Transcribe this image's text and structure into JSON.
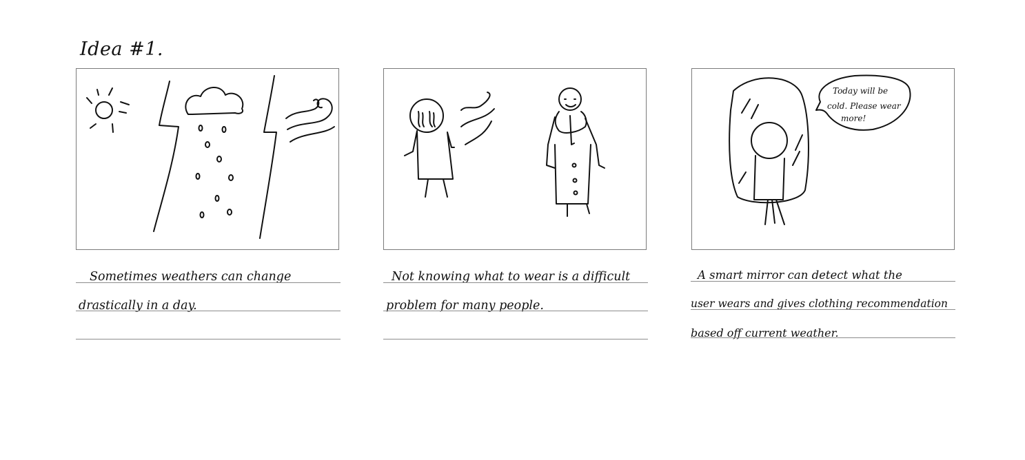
{
  "page": {
    "title": "Idea #1."
  },
  "panels": [
    {
      "caption_lines": [
        "Sometimes weathers can change",
        "drastically in a day."
      ]
    },
    {
      "caption_lines": [
        "Not knowing what to wear is a difficult",
        "problem for many people."
      ]
    },
    {
      "speech_bubble_lines": [
        "Today will be",
        "cold. Please wear",
        "more!"
      ],
      "caption_lines": [
        "A smart mirror can detect what the",
        "user wears and gives clothing recommendation",
        "based off current weather."
      ]
    }
  ]
}
